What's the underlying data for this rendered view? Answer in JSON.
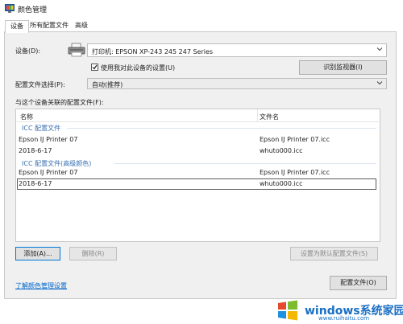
{
  "window": {
    "title": "颜色管理"
  },
  "tabs": [
    {
      "label": "设备"
    },
    {
      "label": "所有配置文件"
    },
    {
      "label": "高级"
    }
  ],
  "device": {
    "label": "设备(D):",
    "selected": "打印机: EPSON XP-243 245 247 Series",
    "use_settings_label": "使用我对此设备的设置(U)",
    "use_settings_checked": true,
    "identify_button": "识别监视器(I)"
  },
  "profile_selection": {
    "label": "配置文件选择(P):",
    "selected": "自动(推荐)"
  },
  "associated_profiles": {
    "label": "与这个设备关联的配置文件(F):",
    "columns": [
      "名称",
      "文件名"
    ],
    "groups": [
      {
        "title": "ICC 配置文件",
        "rows": [
          [
            "Epson IJ Printer 07",
            "Epson IJ Printer 07.icc"
          ],
          [
            "2018-6-17",
            "whuto000.icc"
          ]
        ]
      },
      {
        "title": "ICC 配置文件(高级颜色)",
        "rows": [
          [
            "Epson IJ Printer 07",
            "Epson IJ Printer 07.icc"
          ],
          [
            "2018-6-17",
            "whuto000.icc"
          ]
        ]
      }
    ]
  },
  "buttons": {
    "add": "添加(A)...",
    "remove": "删除(R)",
    "set_default": "设置为默认配置文件(S)",
    "profiles": "配置文件(O)"
  },
  "link": {
    "learn": "了解颜色管理设置"
  },
  "watermark": {
    "brand": "windows系统家园",
    "url": "www.ruihaitu.com"
  },
  "colors": {
    "accent": "#0078d7",
    "link": "#0066cc",
    "group_text": "#3a6fb0"
  }
}
